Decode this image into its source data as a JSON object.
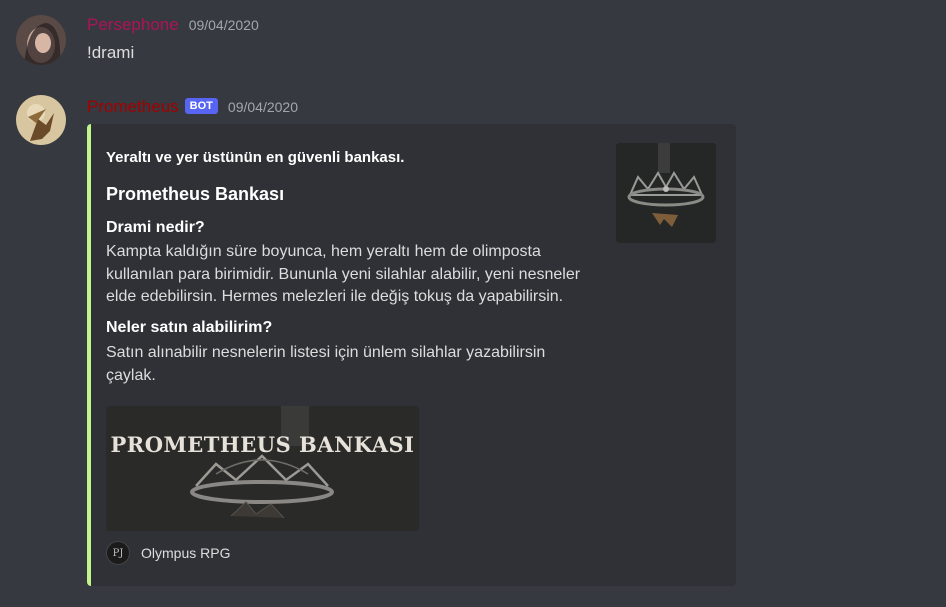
{
  "messages": [
    {
      "username": "Persephone",
      "username_color": "#ad1457",
      "timestamp": "09/04/2020",
      "content": "!drami"
    },
    {
      "username": "Prometheus",
      "username_color": "#a30000",
      "badge": "BOT",
      "timestamp": "09/04/2020",
      "embed": {
        "accent_color": "#c0f58a",
        "author": "Yeraltı ve yer üstünün en güvenli bankası.",
        "title": "Prometheus Bankası",
        "fields": [
          {
            "name": "Drami nedir?",
            "value": "Kampta kaldığın süre boyunca, hem yeraltı hem de olimposta kullanılan para birimidir. Bununla yeni silahlar alabilir, yeni nesneler elde edebilirsin. Hermes melezleri ile değiş tokuş da yapabilirsin."
          },
          {
            "name": "Neler satın alabilirim?",
            "value": "Satın alınabilir nesnelerin listesi için ünlem silahlar yazabilirsin çaylak."
          }
        ],
        "thumbnail_icon": "crown-icon",
        "image_text": "PROMETHEUS BANKASI",
        "footer_icon_text": "PJ",
        "footer": "Olympus RPG"
      }
    }
  ]
}
